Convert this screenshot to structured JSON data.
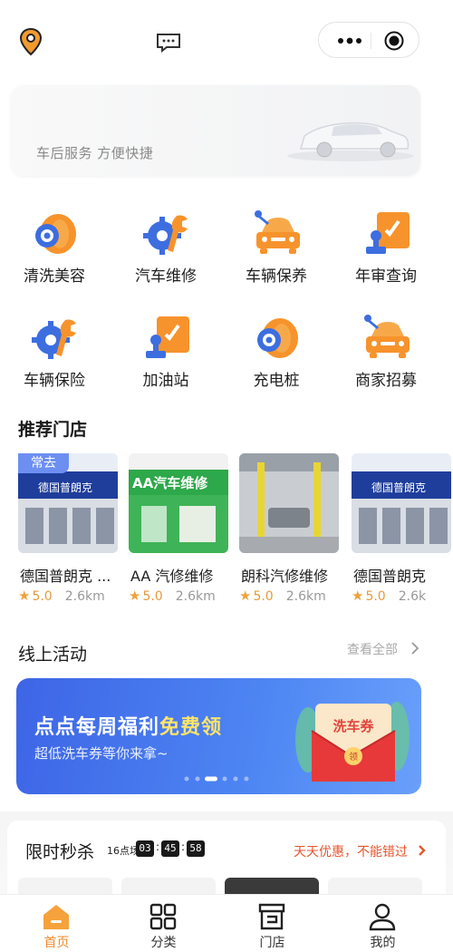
{
  "header": {
    "location_icon": "location-pin-icon",
    "message_icon": "message-icon",
    "capsule": {
      "more_icon": "more-dots-icon",
      "close_icon": "miniprogram-close-icon"
    }
  },
  "banner": {
    "slogan": "车后服务  方便快捷"
  },
  "services": [
    {
      "label": "清洗美容",
      "icon": "tire-icon"
    },
    {
      "label": "汽车维修",
      "icon": "gear-wrench-icon"
    },
    {
      "label": "车辆保养",
      "icon": "car-service-icon"
    },
    {
      "label": "年审查询",
      "icon": "inspection-stamp-icon"
    },
    {
      "label": "车辆保险",
      "icon": "gear-wrench-icon"
    },
    {
      "label": "加油站",
      "icon": "inspection-stamp-icon"
    },
    {
      "label": "充电桩",
      "icon": "tire-icon"
    },
    {
      "label": "商家招募",
      "icon": "car-service-icon"
    }
  ],
  "recommended": {
    "title": "推荐门店",
    "often_tag": "常去",
    "stores": [
      {
        "name": "德国普朗克 ...",
        "score": "5.0",
        "distance": "2.6km",
        "sign": "德国普朗克"
      },
      {
        "name": "AA 汽修维修",
        "score": "5.0",
        "distance": "2.6km",
        "sign": "AA汽车维修"
      },
      {
        "name": "朗科汽修维修",
        "score": "5.0",
        "distance": "2.6km",
        "sign": ""
      },
      {
        "name": "德国普朗克",
        "score": "5.0",
        "distance": "2.6k",
        "sign": "德国普朗克"
      }
    ]
  },
  "activities": {
    "title": "线上活动",
    "view_all": "查看全部",
    "promo": {
      "title_main": "点点每周福利",
      "title_highlight": "免费领",
      "subtitle": "超低洗车券等你来拿~",
      "coupon_label": "洗车券",
      "coupon_seal": "领",
      "colors": {
        "bg": "#4a7cf0",
        "highlight": "#ffe46a"
      }
    }
  },
  "flash_sale": {
    "title": "限时秒杀",
    "session": "16点场",
    "hours": "03",
    "minutes": "45",
    "seconds": "58",
    "slogan": "天天优惠，不能错过"
  },
  "tabbar": [
    {
      "label": "首页",
      "icon": "home-icon",
      "active": true
    },
    {
      "label": "分类",
      "icon": "category-grid-icon",
      "active": false
    },
    {
      "label": "门店",
      "icon": "store-icon",
      "active": false
    },
    {
      "label": "我的",
      "icon": "user-icon",
      "active": false
    }
  ],
  "colors": {
    "accent": "#f08a2c",
    "star": "#f0a13a",
    "price_red": "#e4562f"
  }
}
